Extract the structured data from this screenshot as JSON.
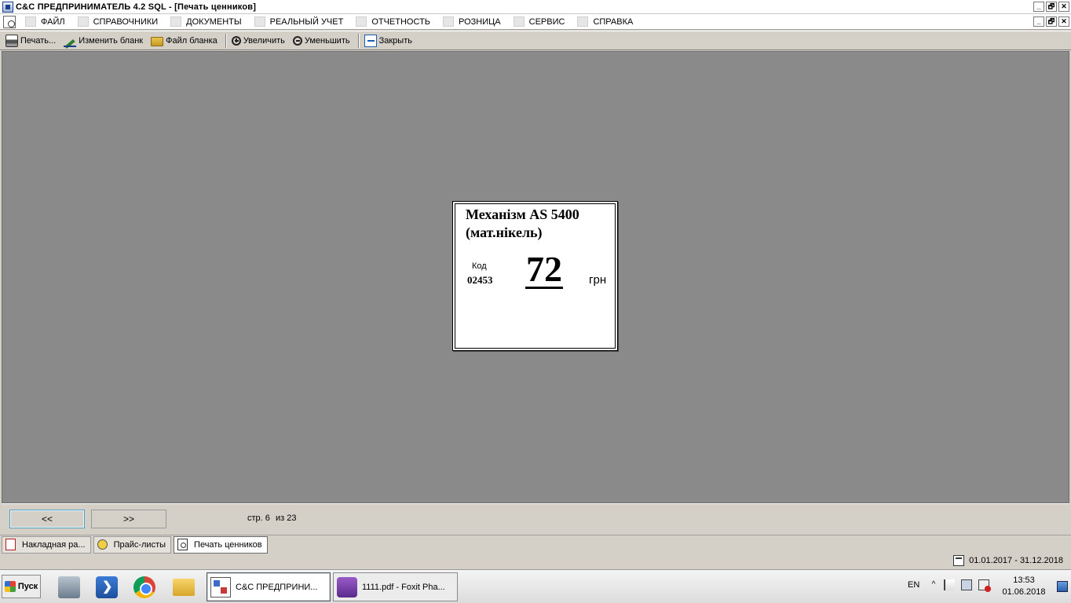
{
  "window": {
    "title": "C&C  ПРЕДПРИНИМАТЕЛЬ 4.2 SQL - [Печать ценников]",
    "buttons": [
      "_",
      "🗗",
      "✕"
    ]
  },
  "menu": {
    "items": [
      {
        "label": "ФАЙЛ",
        "icon": "file-icon"
      },
      {
        "label": "СПРАВОЧНИКИ",
        "icon": "home-icon"
      },
      {
        "label": "ДОКУМЕНТЫ",
        "icon": "document-icon"
      },
      {
        "label": "РЕАЛЬНЫЙ УЧЕТ",
        "icon": "ledger-icon"
      },
      {
        "label": "ОТЧЕТНОСТЬ",
        "icon": "report-icon"
      },
      {
        "label": "РОЗНИЦА",
        "icon": "retail-icon"
      },
      {
        "label": "СЕРВИС",
        "icon": "service-icon"
      },
      {
        "label": "СПРАВКА",
        "icon": "help-icon"
      }
    ],
    "buttons": [
      "_",
      "🗗",
      "✕"
    ]
  },
  "toolbar": {
    "print_label": "Печать...",
    "edit_form_label": "Изменить бланк",
    "form_file_label": "Файл бланка",
    "zoom_in_label": "Увеличить",
    "zoom_out_label": "Уменьшить",
    "close_label": "Закрыть"
  },
  "price_tag": {
    "product_name": "Механізм AS 5400 (мат.нікель)",
    "code_label": "Код",
    "code_value": "02453",
    "price": "72",
    "currency": "грн"
  },
  "pager": {
    "prev_label": "<<",
    "next_label": ">>",
    "page_text": "стр. 6",
    "total_text": "из 23"
  },
  "mdi_tabs": [
    {
      "label": "Накладная ра...",
      "icon": "invoice-icon",
      "active": false
    },
    {
      "label": "Прайс-листы",
      "icon": "price-list-icon",
      "active": false
    },
    {
      "label": "Печать ценников",
      "icon": "print-tags-icon",
      "active": true
    }
  ],
  "status": {
    "period": "01.01.2017 - 31.12.2018"
  },
  "taskbar": {
    "start_label": "Пуск",
    "tasks": [
      {
        "label": "C&C  ПРЕДПРИНИ...",
        "active": true
      },
      {
        "label": "1111.pdf - Foxit Pha...",
        "active": false
      }
    ],
    "language": "EN",
    "time": "13:53",
    "date": "01.06.2018"
  }
}
